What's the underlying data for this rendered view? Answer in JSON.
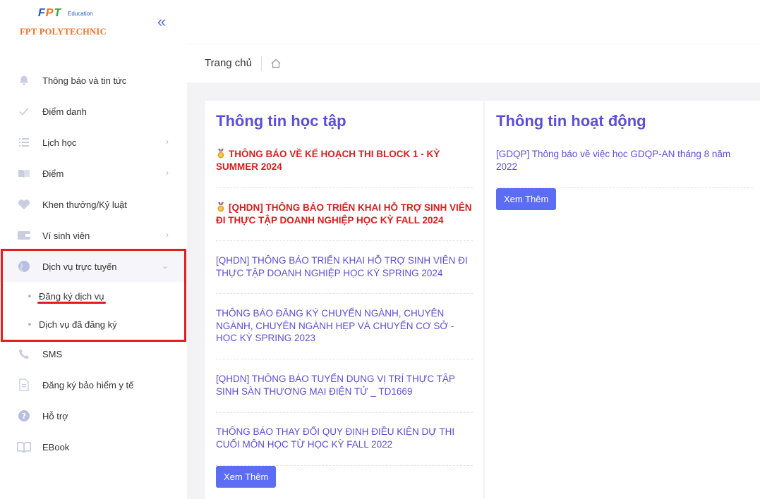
{
  "logo": {
    "fpt_f": "F",
    "fpt_p": "P",
    "fpt_t": "T",
    "edu": "Education",
    "poly": "FPT POLYTECHNIC"
  },
  "sidebar": {
    "collapse_glyph": "«",
    "items": [
      {
        "label": "Thông báo và tin tức"
      },
      {
        "label": "Điểm danh"
      },
      {
        "label": "Lịch học"
      },
      {
        "label": "Điểm"
      },
      {
        "label": "Khen thưởng/Kỷ luật"
      },
      {
        "label": "Ví sinh viên"
      },
      {
        "label": "Dịch vụ trực tuyến"
      },
      {
        "label": "SMS"
      },
      {
        "label": "Đăng ký bảo hiểm y tế"
      },
      {
        "label": "Hỗ trợ"
      },
      {
        "label": "EBook"
      }
    ],
    "sub_items": [
      {
        "label": "Đăng ký dịch vụ"
      },
      {
        "label": "Dịch vụ đã đăng ký"
      }
    ]
  },
  "breadcrumb": {
    "title": "Trang chủ"
  },
  "learning": {
    "title": "Thông tin học tập",
    "news": [
      {
        "text": "THÔNG BÁO VỀ KẾ HOẠCH THI BLOCK 1 - KỲ SUMMER 2024"
      },
      {
        "text": "[QHDN] THÔNG BÁO TRIỂN KHAI HỖ TRỢ SINH VIÊN ĐI THỰC TẬP DOANH NGHIỆP HỌC KỲ FALL 2024"
      },
      {
        "text": "[QHDN] THÔNG BÁO TRIỂN KHAI HỖ TRỢ SINH VIÊN ĐI THỰC TẬP DOANH NGHIỆP HỌC KỲ SPRING 2024"
      },
      {
        "text": "THÔNG BÁO ĐĂNG KÝ CHUYỂN NGÀNH, CHUYÊN NGÀNH, CHUYÊN NGÀNH HẸP VÀ CHUYỂN CƠ SỞ - HỌC KỲ SPRING 2023"
      },
      {
        "text": "[QHDN] THÔNG BÁO TUYỂN DỤNG VỊ TRÍ THỰC TẬP SINH SÀN THƯƠNG MẠI ĐIỆN TỬ _ TD1669"
      },
      {
        "text": "THÔNG BÁO THAY ĐỔI QUY ĐỊNH ĐIỀU KIỆN DỰ THI CUỐI MÔN HỌC TỪ HỌC KỲ FALL 2022"
      }
    ],
    "more_label": "Xem Thêm"
  },
  "activity": {
    "title": "Thông tin hoạt động",
    "news": [
      {
        "text": "[GDQP] Thông báo về việc học GDQP-AN tháng 8 năm 2022"
      }
    ],
    "more_label": "Xem Thêm"
  },
  "colors": {
    "accent": "#5b4fd4",
    "button": "#5b6cf5",
    "alert": "#d42020",
    "highlight": "#e21e1e"
  }
}
